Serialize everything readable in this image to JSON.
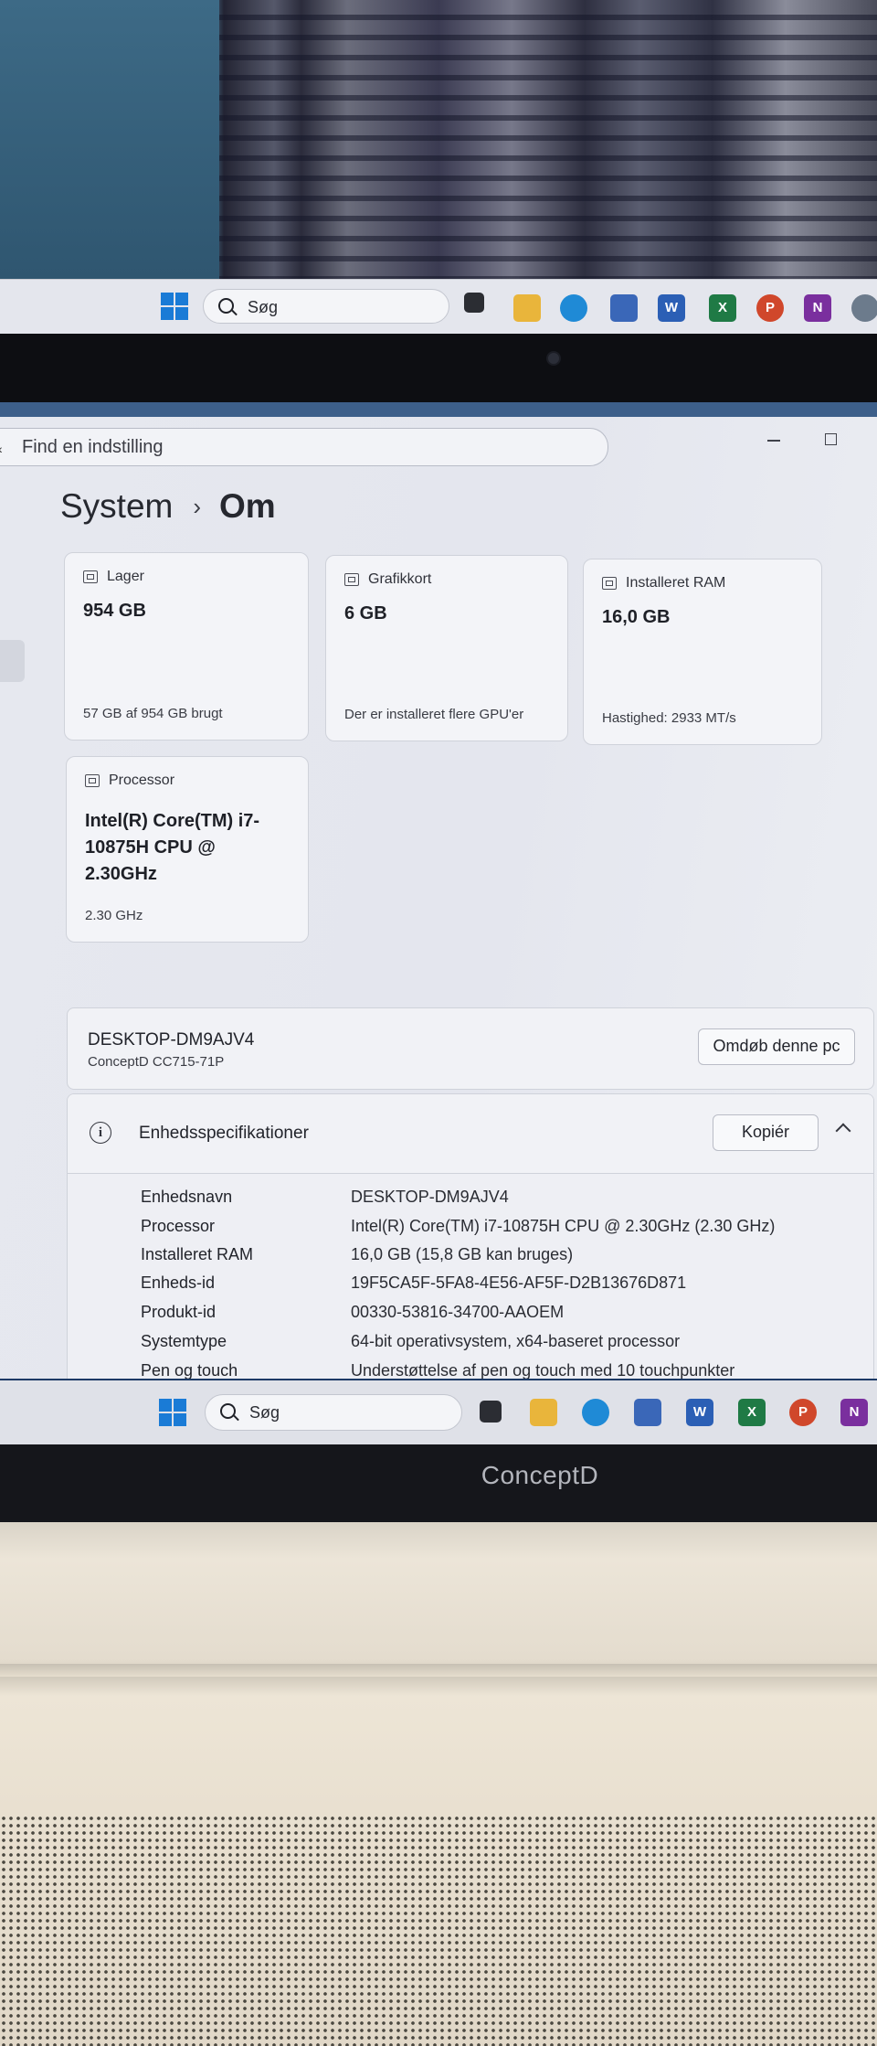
{
  "top_monitor": {
    "taskbar": {
      "search_label": "Søg",
      "apps": [
        "task-view",
        "file-explorer",
        "edge",
        "store",
        "word",
        "excel",
        "powerpoint",
        "onenote",
        "settings"
      ]
    }
  },
  "settings_window": {
    "search": {
      "placeholder": "Find en indstilling"
    },
    "breadcrumb": {
      "root": "System",
      "separator": "›",
      "current": "Om"
    },
    "cards": {
      "storage": {
        "title": "Lager",
        "value": "954 GB",
        "sub": "57 GB af 954 GB brugt",
        "icon": "storage-icon"
      },
      "graphics": {
        "title": "Grafikkort",
        "value": "6 GB",
        "sub": "Der er installeret flere GPU'er",
        "icon": "graphics-card-icon"
      },
      "ram": {
        "title": "Installeret RAM",
        "value": "16,0 GB",
        "sub": "Hastighed: 2933 MT/s",
        "icon": "ram-icon"
      },
      "processor": {
        "title": "Processor",
        "value": "Intel(R) Core(TM) i7-10875H CPU @ 2.30GHz",
        "sub": "2.30 GHz",
        "icon": "processor-icon"
      }
    },
    "device": {
      "name": "DESKTOP-DM9AJV4",
      "model": "ConceptD CC715-71P",
      "rename_label": "Omdøb denne pc"
    },
    "specs": {
      "title": "Enhedsspecifikationer",
      "copy_label": "Kopiér",
      "rows": [
        {
          "key": "Enhedsnavn",
          "value": "DESKTOP-DM9AJV4"
        },
        {
          "key": "Processor",
          "value": "Intel(R) Core(TM) i7-10875H CPU @ 2.30GHz (2.30 GHz)"
        },
        {
          "key": "Installeret RAM",
          "value": "16,0 GB (15,8 GB kan bruges)"
        },
        {
          "key": "Enheds-id",
          "value": "19F5CA5F-5FA8-4E56-AF5F-D2B13676D871"
        },
        {
          "key": "Produkt-id",
          "value": "00330-53816-34700-AAOEM"
        },
        {
          "key": "Systemtype",
          "value": "64-bit operativsystem, x64-baseret processor"
        },
        {
          "key": "Pen og touch",
          "value": "Understøttelse af pen og touch med 10 touchpunkter"
        }
      ]
    }
  },
  "taskbar": {
    "search_label": "Søg",
    "apps": [
      "task-view",
      "file-explorer",
      "edge",
      "store",
      "word",
      "excel",
      "powerpoint",
      "onenote"
    ]
  },
  "laptop": {
    "brand": "ConceptD"
  },
  "colors": {
    "accent": "#1a7bd6",
    "window_bg": "#e6e8ef",
    "card_bg": "#f3f4f8"
  }
}
